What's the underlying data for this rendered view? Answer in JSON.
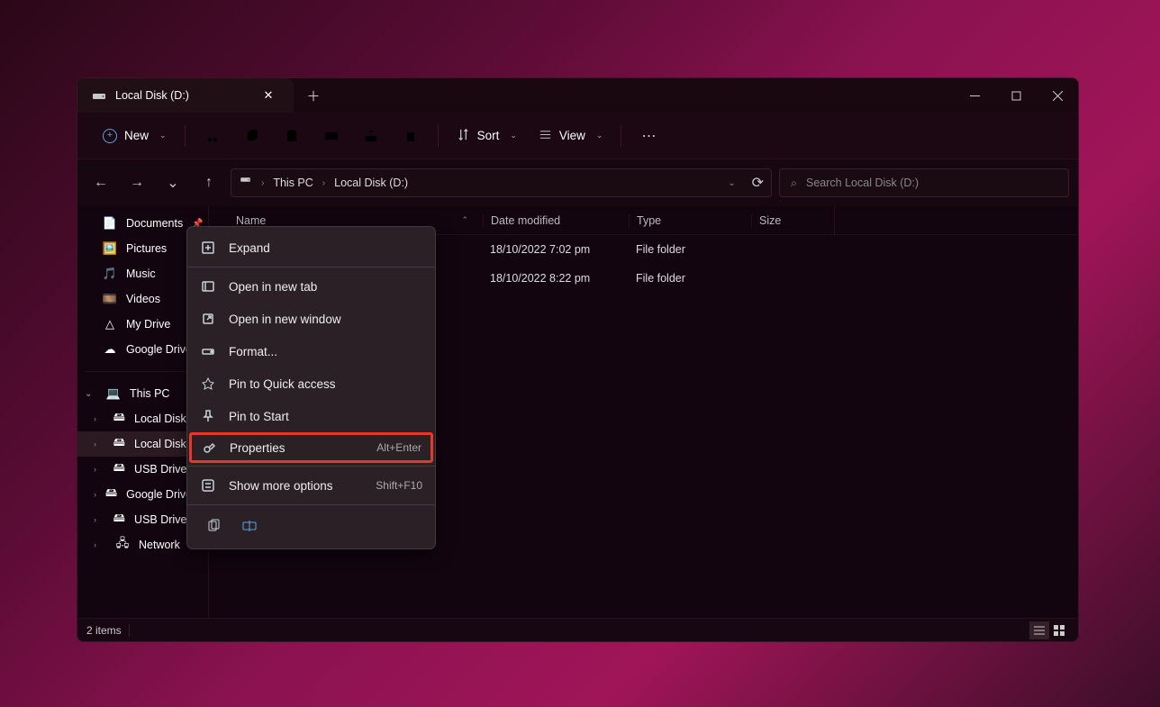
{
  "tab": {
    "title": "Local Disk (D:)"
  },
  "toolbar": {
    "new_label": "New",
    "sort_label": "Sort",
    "view_label": "View"
  },
  "breadcrumb": {
    "parts": [
      "This PC",
      "Local Disk (D:)"
    ]
  },
  "search": {
    "placeholder": "Search Local Disk (D:)"
  },
  "sidebar": {
    "quick": [
      {
        "label": "Documents",
        "icon": "doc"
      },
      {
        "label": "Pictures",
        "icon": "pic"
      },
      {
        "label": "Music",
        "icon": "music"
      },
      {
        "label": "Videos",
        "icon": "video"
      },
      {
        "label": "My Drive",
        "icon": "gdrive"
      },
      {
        "label": "Google Drive",
        "icon": "drive"
      }
    ],
    "thispc_label": "This PC",
    "drives": [
      {
        "label": "Local Disk (C:)"
      },
      {
        "label": "Local Disk (D:)"
      },
      {
        "label": "USB Drive (E:)"
      },
      {
        "label": "Google Drive (G:)"
      },
      {
        "label": "USB Drive (E:)"
      },
      {
        "label": "Network"
      }
    ]
  },
  "columns": {
    "name": "Name",
    "date": "Date modified",
    "type": "Type",
    "size": "Size"
  },
  "rows": [
    {
      "date": "18/10/2022 7:02 pm",
      "type": "File folder"
    },
    {
      "date": "18/10/2022 8:22 pm",
      "type": "File folder"
    }
  ],
  "status": {
    "items": "2 items"
  },
  "context_menu": {
    "expand": "Expand",
    "open_tab": "Open in new tab",
    "open_window": "Open in new window",
    "format": "Format...",
    "pin_quick": "Pin to Quick access",
    "pin_start": "Pin to Start",
    "properties": "Properties",
    "properties_key": "Alt+Enter",
    "more": "Show more options",
    "more_key": "Shift+F10"
  }
}
